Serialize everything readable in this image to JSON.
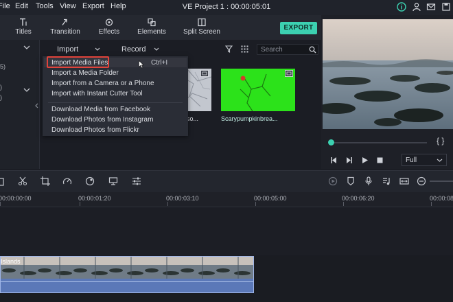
{
  "menubar": {
    "items": [
      "File",
      "Edit",
      "Tools",
      "View",
      "Export",
      "Help"
    ],
    "title": "VE Project 1 : 00:00:05:01"
  },
  "toolbar": {
    "tools": [
      {
        "label": "Titles",
        "icon": "titles-icon"
      },
      {
        "label": "Transition",
        "icon": "transition-icon"
      },
      {
        "label": "Effects",
        "icon": "effects-icon"
      },
      {
        "label": "Elements",
        "icon": "elements-icon"
      },
      {
        "label": "Split Screen",
        "icon": "split-screen-icon"
      }
    ],
    "export_label": "EXPORT"
  },
  "library": {
    "import_label": "Import",
    "record_label": "Record",
    "search_placeholder": "Search"
  },
  "dropdown": {
    "items": [
      {
        "label": "Import Media Files",
        "shortcut": "Ctrl+I"
      },
      {
        "label": "Import a Media Folder"
      },
      {
        "label": "Import from a Camera or a Phone"
      },
      {
        "label": "Import with Instant Cutter Tool"
      },
      {
        "label": "Download Media from Facebook"
      },
      {
        "label": "Download Photos from Instagram"
      },
      {
        "label": "Download Photos from Flickr"
      }
    ]
  },
  "media": {
    "items": [
      {
        "label": "so..."
      },
      {
        "label": "Scarypumpkinbrea..."
      }
    ]
  },
  "preview": {
    "quality": "Full"
  },
  "timeline": {
    "timecodes": [
      "00:00:00:00",
      "00:00:01:20",
      "00:00:03:10",
      "00:00:05:00",
      "00:00:06:20",
      "00:00:08"
    ],
    "clip_label": "Islands"
  },
  "colors": {
    "accent": "#3cd1b1",
    "highlight_box": "#e0433b",
    "clip": "#5b78b8"
  }
}
